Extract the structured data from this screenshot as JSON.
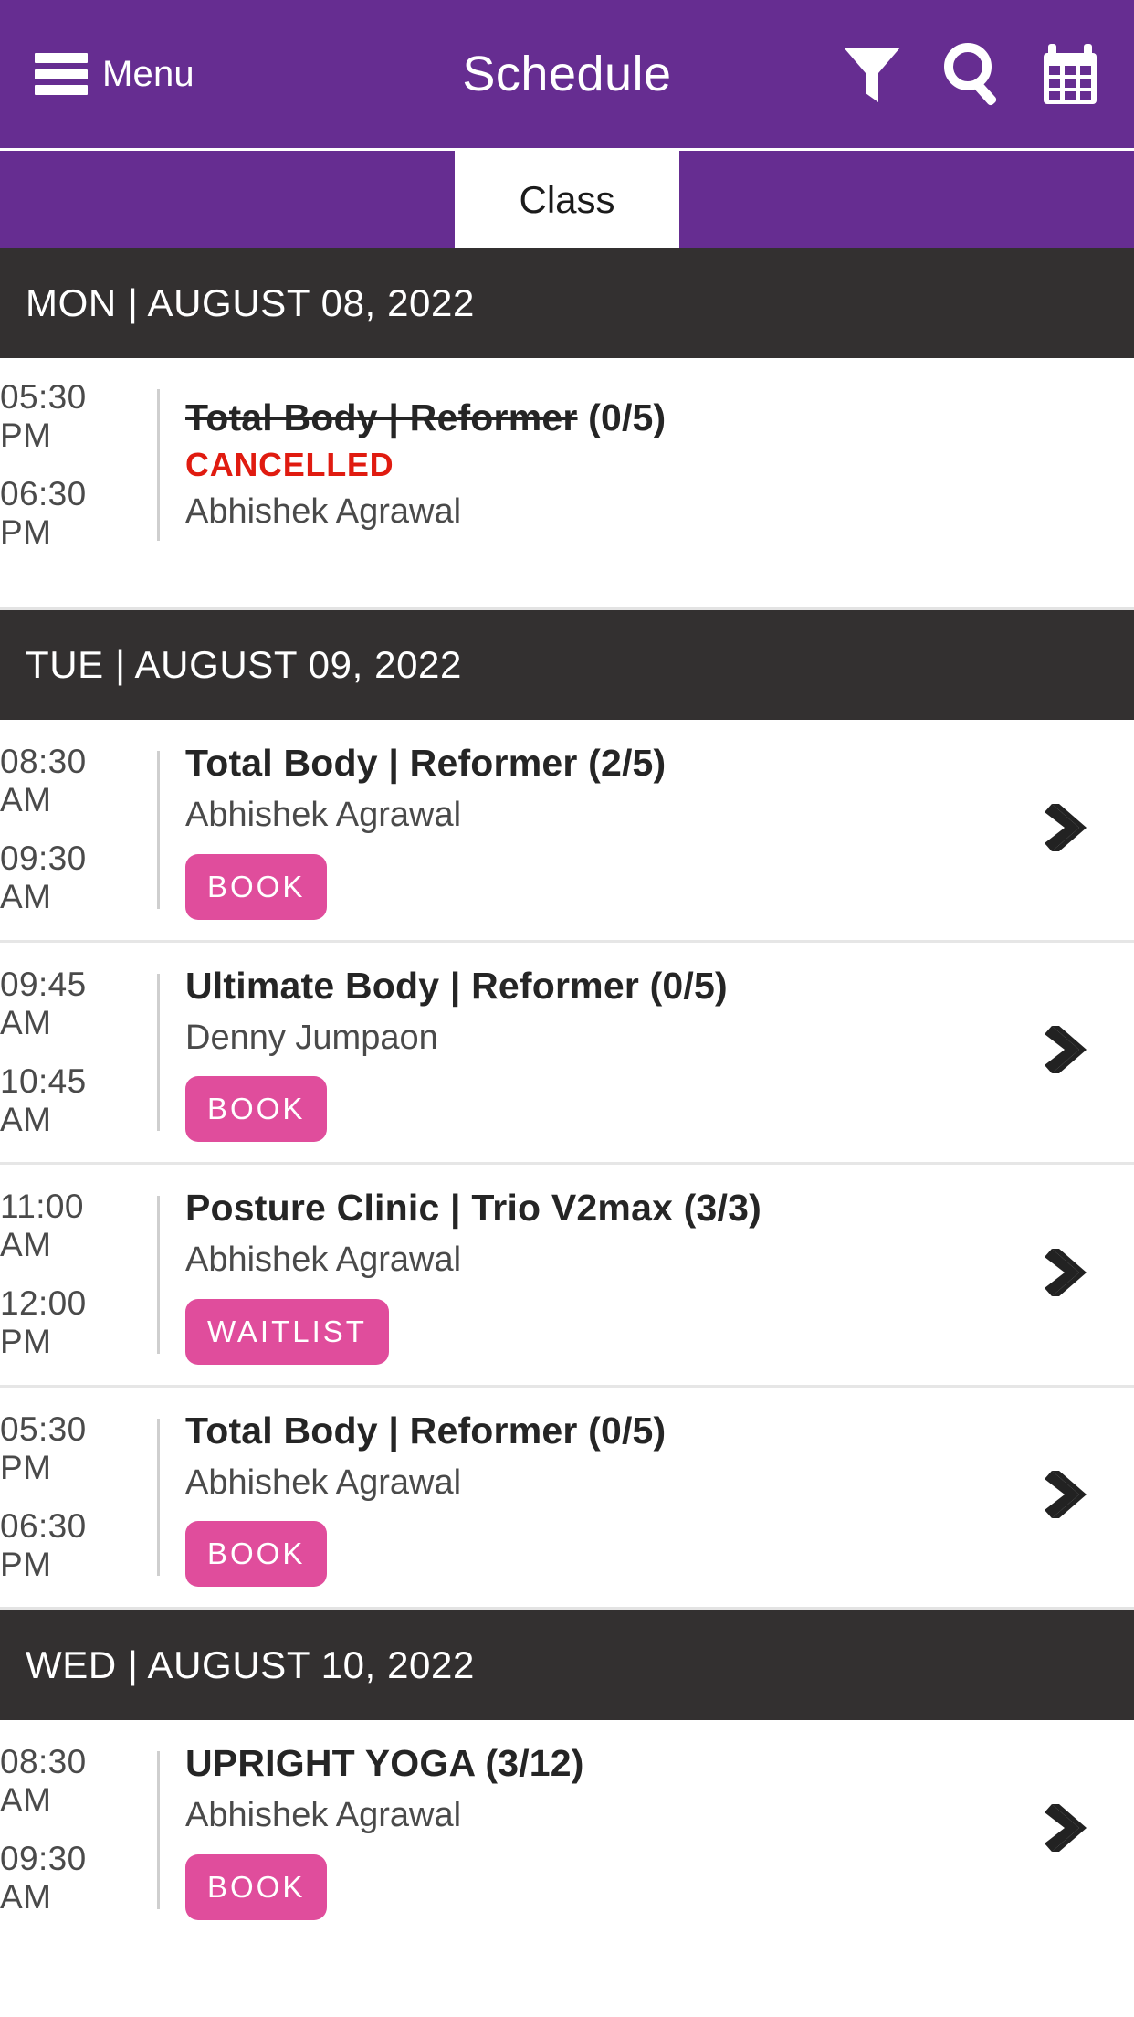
{
  "theme": {
    "primary": "#662D91",
    "header_bar": "#333030",
    "accent_pink": "#E04D9C",
    "cancelled_red": "#E01B10"
  },
  "appbar": {
    "menu_label": "Menu",
    "title": "Schedule",
    "actions": [
      {
        "name": "filter-icon",
        "label": "Filter"
      },
      {
        "name": "search-icon",
        "label": "Search"
      },
      {
        "name": "calendar-icon",
        "label": "Calendar"
      }
    ]
  },
  "tabs": [
    {
      "label": "Class",
      "selected": true
    }
  ],
  "days": [
    {
      "header": "MON | AUGUST 08, 2022",
      "classes": [
        {
          "start_time": "05:30 PM",
          "end_time": "06:30 PM",
          "title_struck": "Total Body | Reformer",
          "title_capacity": "(0/5)",
          "status": "CANCELLED",
          "instructor": "Abhishek Agrawal",
          "action": null,
          "has_arrow": false
        }
      ]
    },
    {
      "header": "TUE | AUGUST 09, 2022",
      "classes": [
        {
          "start_time": "08:30 AM",
          "end_time": "09:30 AM",
          "title": "Total Body | Reformer (2/5)",
          "instructor": "Abhishek Agrawal",
          "action": "BOOK",
          "has_arrow": true
        },
        {
          "start_time": "09:45 AM",
          "end_time": "10:45 AM",
          "title": "Ultimate Body | Reformer (0/5)",
          "instructor": "Denny Jumpaon",
          "action": "BOOK",
          "has_arrow": true
        },
        {
          "start_time": "11:00 AM",
          "end_time": "12:00 PM",
          "title": "Posture Clinic | Trio V2max (3/3)",
          "instructor": "Abhishek Agrawal",
          "action": "WAITLIST",
          "has_arrow": true
        },
        {
          "start_time": "05:30 PM",
          "end_time": "06:30 PM",
          "title": "Total Body | Reformer (0/5)",
          "instructor": "Abhishek Agrawal",
          "action": "BOOK",
          "has_arrow": true
        }
      ]
    },
    {
      "header": "WED | AUGUST 10, 2022",
      "classes": [
        {
          "start_time": "08:30 AM",
          "end_time": "09:30 AM",
          "title": "UPRIGHT YOGA (3/12)",
          "instructor": "Abhishek Agrawal",
          "action": "BOOK",
          "has_arrow": true
        }
      ]
    }
  ]
}
